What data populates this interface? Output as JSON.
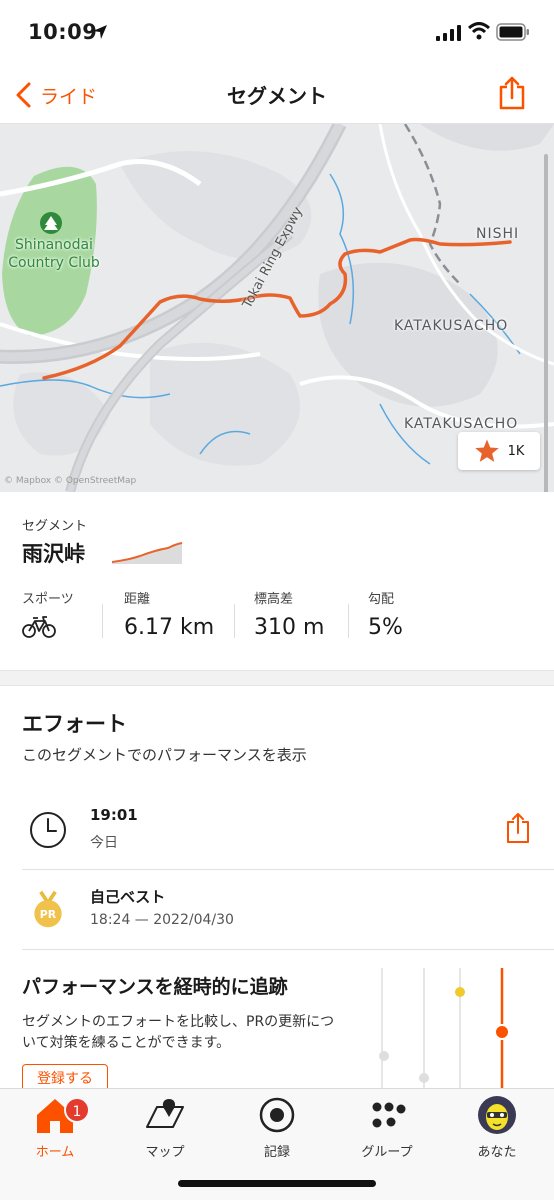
{
  "status": {
    "time": "10:09"
  },
  "nav": {
    "back_label": "ライド",
    "title": "セグメント"
  },
  "map": {
    "labels": {
      "club_line1": "Shinanodai",
      "club_line2": "Country Club",
      "road": "Tokai Ring Expwy",
      "nishi": "NISHI",
      "katakusacho1": "KATAKUSACHO",
      "katakusacho2": "KATAKUSACHO"
    },
    "star_count": "1K",
    "attribution": "© Mapbox © OpenStreetMap"
  },
  "segment": {
    "label": "セグメント",
    "name": "雨沢峠"
  },
  "stats": {
    "sport_label": "スポーツ",
    "distance_label": "距離",
    "distance_value": "6.17 km",
    "elevation_label": "標高差",
    "elevation_value": "310 m",
    "grade_label": "勾配",
    "grade_value": "5%"
  },
  "efforts": {
    "title": "エフォート",
    "subtitle": "このセグメントでのパフォーマンスを表示",
    "rows": [
      {
        "main": "19:01",
        "sub": "今日"
      },
      {
        "main": "自己ベスト",
        "sub": "18:24 — 2022/04/30",
        "badge": "PR"
      }
    ]
  },
  "promo": {
    "title": "パフォーマンスを経時的に追跡",
    "desc": "セグメントのエフォートを比較し、PRの更新について対策を練ることができます。",
    "button": "登録する"
  },
  "tabs": [
    {
      "label": "ホーム",
      "badge": "1"
    },
    {
      "label": "マップ"
    },
    {
      "label": "記録"
    },
    {
      "label": "グループ"
    },
    {
      "label": "あなた"
    }
  ],
  "colors": {
    "accent": "#fc5200",
    "route": "#e8622b",
    "park": "#a8d8a0"
  }
}
